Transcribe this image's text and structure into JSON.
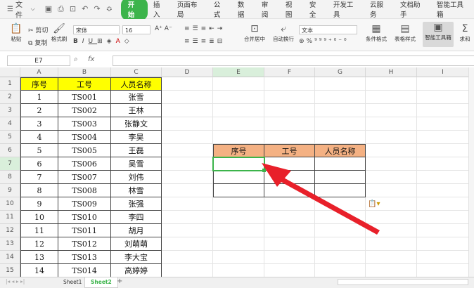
{
  "menubar": {
    "file_label": "文件",
    "tabs": [
      "开始",
      "插入",
      "页面布局",
      "公式",
      "数据",
      "审阅",
      "视图",
      "安全",
      "开发工具",
      "云服务",
      "文档助手",
      "智能工具箱"
    ]
  },
  "ribbon": {
    "paste": "粘贴",
    "cut": "剪切",
    "copy": "复制",
    "format_painter": "格式刷",
    "font_name": "宋体",
    "font_size": "16",
    "merge_center": "合并居中",
    "auto_wrap": "自动换行",
    "number_format": "文本",
    "conditional_format": "条件格式",
    "table_style": "表格样式",
    "smart_toolbox": "智能工具箱",
    "sum": "求和"
  },
  "formula": {
    "name_box": "E7",
    "fx": "fx"
  },
  "columns": [
    "A",
    "B",
    "C",
    "D",
    "E",
    "F",
    "G",
    "H",
    "I"
  ],
  "rows": [
    "1",
    "2",
    "3",
    "4",
    "5",
    "6",
    "7",
    "8",
    "9",
    "10",
    "11",
    "12",
    "13",
    "14",
    "15"
  ],
  "table": {
    "headers": [
      "序号",
      "工号",
      "人员名称"
    ],
    "data": [
      [
        "1",
        "TS001",
        "张雪"
      ],
      [
        "2",
        "TS002",
        "王林"
      ],
      [
        "3",
        "TS003",
        "张静文"
      ],
      [
        "4",
        "TS004",
        "李昊"
      ],
      [
        "5",
        "TS005",
        "王磊"
      ],
      [
        "6",
        "TS006",
        "吴雪"
      ],
      [
        "7",
        "TS007",
        "刘伟"
      ],
      [
        "8",
        "TS008",
        "林雪"
      ],
      [
        "9",
        "TS009",
        "张强"
      ],
      [
        "10",
        "TS010",
        "李四"
      ],
      [
        "11",
        "TS011",
        "胡月"
      ],
      [
        "12",
        "TS012",
        "刘萌萌"
      ],
      [
        "13",
        "TS013",
        "李大宝"
      ],
      [
        "14",
        "TS014",
        "高婷婷"
      ]
    ]
  },
  "lookup_table": {
    "headers": [
      "序号",
      "工号",
      "人员名称"
    ]
  },
  "sheets": [
    "Sheet1",
    "Sheet2"
  ],
  "active_sheet": "Sheet2",
  "colors": {
    "accent": "#3cb44b",
    "header_yellow": "#ffff00",
    "header_orange": "#f4b183",
    "arrow": "#e8202a"
  }
}
